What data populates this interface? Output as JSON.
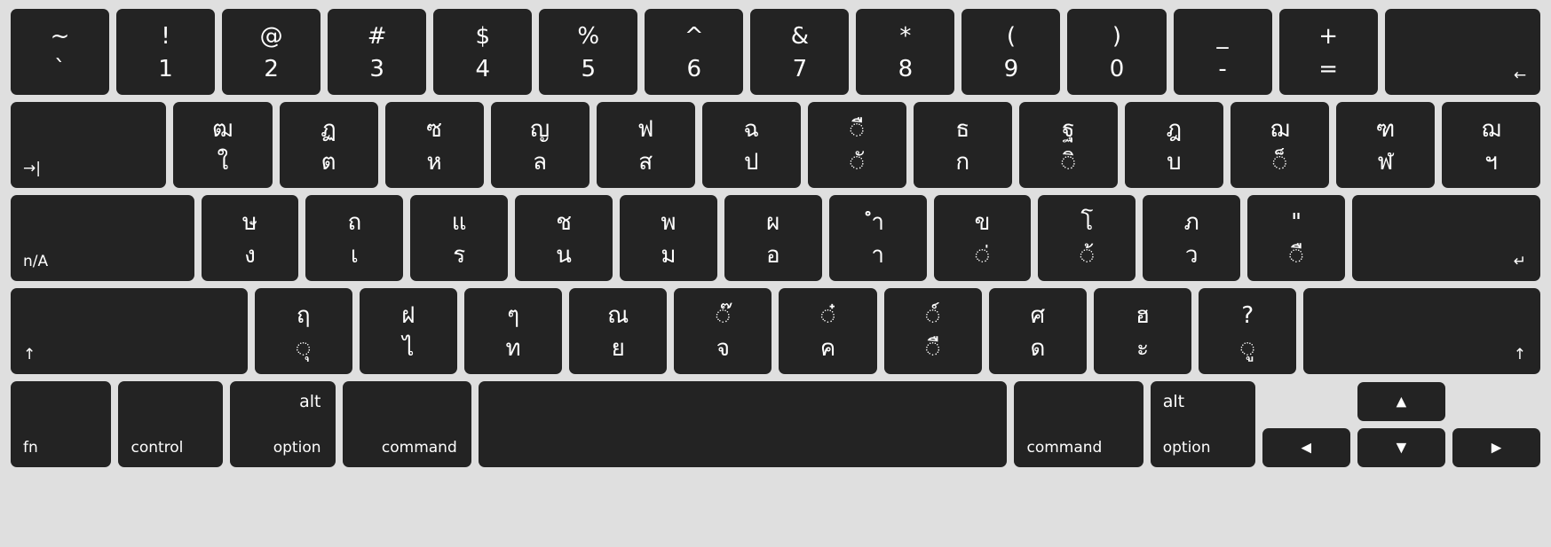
{
  "keyboard": {
    "background_color": "#dfdfdf",
    "key_color": "#232323",
    "text_color": "#ffffff",
    "rows": [
      {
        "name": "number-row",
        "keys": [
          {
            "name": "key-backquote",
            "top": "~",
            "bottom": "`",
            "style": "pair"
          },
          {
            "name": "key-1",
            "top": "!",
            "bottom": "1",
            "style": "pair"
          },
          {
            "name": "key-2",
            "top": "@",
            "bottom": "2",
            "style": "pair"
          },
          {
            "name": "key-3",
            "top": "#",
            "bottom": "3",
            "style": "pair"
          },
          {
            "name": "key-4",
            "top": "$",
            "bottom": "4",
            "style": "pair"
          },
          {
            "name": "key-5",
            "top": "%",
            "bottom": "5",
            "style": "pair"
          },
          {
            "name": "key-6",
            "top": "^",
            "bottom": "6",
            "style": "pair"
          },
          {
            "name": "key-7",
            "top": "&",
            "bottom": "7",
            "style": "pair"
          },
          {
            "name": "key-8",
            "top": "*",
            "bottom": "8",
            "style": "pair"
          },
          {
            "name": "key-9",
            "top": "(",
            "bottom": "9",
            "style": "pair"
          },
          {
            "name": "key-0",
            "top": ")",
            "bottom": "0",
            "style": "pair"
          },
          {
            "name": "key-minus",
            "top": "_",
            "bottom": "-",
            "style": "pair"
          },
          {
            "name": "key-equal",
            "top": "+",
            "bottom": "=",
            "style": "pair"
          },
          {
            "name": "key-delete",
            "bottom_right": "←",
            "style": "corner-br"
          }
        ]
      },
      {
        "name": "tab-row",
        "keys": [
          {
            "name": "key-tab",
            "bottom_left": "→|",
            "style": "corner-bl"
          },
          {
            "name": "key-q",
            "top": "ฒ",
            "bottom": "ใ",
            "style": "pair"
          },
          {
            "name": "key-w",
            "top": "ฏ",
            "bottom": "ต",
            "style": "pair"
          },
          {
            "name": "key-e",
            "top": "ซ",
            "bottom": "ห",
            "style": "pair"
          },
          {
            "name": "key-r",
            "top": "ญ",
            "bottom": "ล",
            "style": "pair"
          },
          {
            "name": "key-t",
            "top": "ฟ",
            "bottom": "ส",
            "style": "pair"
          },
          {
            "name": "key-y",
            "top": "ฉ",
            "bottom": "ป",
            "style": "pair"
          },
          {
            "name": "key-u",
            "top": "◌ื",
            "bottom": "◌ั",
            "style": "pair"
          },
          {
            "name": "key-i",
            "top": "ธ",
            "bottom": "ก",
            "style": "pair"
          },
          {
            "name": "key-o",
            "top": "ฐ",
            "bottom": "◌ิ",
            "style": "pair"
          },
          {
            "name": "key-p",
            "top": "ฎ",
            "bottom": "บ",
            "style": "pair"
          },
          {
            "name": "key-bracketleft",
            "top": "ฌ",
            "bottom": "◌็",
            "style": "pair"
          },
          {
            "name": "key-bracketright",
            "top": "ฑ",
            "bottom": "ฬ",
            "style": "pair"
          },
          {
            "name": "key-backslash",
            "top": "ฌ",
            "bottom": "ฯ",
            "style": "pair"
          }
        ]
      },
      {
        "name": "home-row",
        "keys": [
          {
            "name": "key-capslock",
            "bottom_left": "n/A",
            "style": "corner-bl"
          },
          {
            "name": "key-a",
            "top": "ษ",
            "bottom": "ง",
            "style": "pair"
          },
          {
            "name": "key-s",
            "top": "ถ",
            "bottom": "เ",
            "style": "pair"
          },
          {
            "name": "key-d",
            "top": "แ",
            "bottom": "ร",
            "style": "pair"
          },
          {
            "name": "key-f",
            "top": "ช",
            "bottom": "น",
            "style": "pair"
          },
          {
            "name": "key-g",
            "top": "พ",
            "bottom": "ม",
            "style": "pair"
          },
          {
            "name": "key-h",
            "top": "ผ",
            "bottom": "อ",
            "style": "pair"
          },
          {
            "name": "key-j",
            "top": "ำ",
            "bottom": "า",
            "style": "pair"
          },
          {
            "name": "key-k",
            "top": "ข",
            "bottom": "◌่",
            "style": "pair"
          },
          {
            "name": "key-l",
            "top": "โ",
            "bottom": "◌้",
            "style": "pair"
          },
          {
            "name": "key-semicolon",
            "top": "ภ",
            "bottom": "ว",
            "style": "pair"
          },
          {
            "name": "key-quote",
            "top": "\"",
            "bottom": "◌ื",
            "style": "pair"
          },
          {
            "name": "key-return",
            "bottom_right": "↵",
            "style": "corner-br"
          }
        ]
      },
      {
        "name": "shift-row",
        "keys": [
          {
            "name": "key-shift-left",
            "bottom_left": "↑",
            "style": "corner-bl"
          },
          {
            "name": "key-z",
            "top": "ฤ",
            "bottom": "◌ุ",
            "style": "pair"
          },
          {
            "name": "key-x",
            "top": "ฝ",
            "bottom": "ไ",
            "style": "pair"
          },
          {
            "name": "key-c",
            "top": "ๆ",
            "bottom": "ท",
            "style": "pair"
          },
          {
            "name": "key-v",
            "top": "ณ",
            "bottom": "ย",
            "style": "pair"
          },
          {
            "name": "key-b",
            "top": "◌๊",
            "bottom": "จ",
            "style": "pair"
          },
          {
            "name": "key-n",
            "top": "◌๋",
            "bottom": "ค",
            "style": "pair"
          },
          {
            "name": "key-m",
            "top": "◌์",
            "bottom": "◌ื",
            "style": "pair"
          },
          {
            "name": "key-comma",
            "top": "ศ",
            "bottom": "ด",
            "style": "pair"
          },
          {
            "name": "key-period",
            "top": "ฮ",
            "bottom": "ะ",
            "style": "pair"
          },
          {
            "name": "key-slash",
            "top": "?",
            "bottom": "◌ู",
            "style": "pair"
          },
          {
            "name": "key-shift-right",
            "bottom_right": "↑",
            "style": "corner-br"
          }
        ]
      },
      {
        "name": "bottom-row",
        "keys": [
          {
            "name": "key-fn",
            "bottom_left": "fn",
            "style": "corner-bl"
          },
          {
            "name": "key-control",
            "bottom_left": "control",
            "style": "corner-bl"
          },
          {
            "name": "key-option-left",
            "top_right": "alt",
            "bottom_right": "option",
            "style": "corner-tr-br"
          },
          {
            "name": "key-command-left",
            "bottom_right": "command",
            "style": "corner-br"
          },
          {
            "name": "key-space",
            "style": "blank"
          },
          {
            "name": "key-command-right",
            "bottom_left": "command",
            "style": "corner-bl"
          },
          {
            "name": "key-option-right",
            "top_left": "alt",
            "bottom_left": "option",
            "style": "corner-tl-bl"
          }
        ],
        "arrows": {
          "up": "▲",
          "down": "▼",
          "left": "◀",
          "right": "▶"
        }
      }
    ]
  }
}
